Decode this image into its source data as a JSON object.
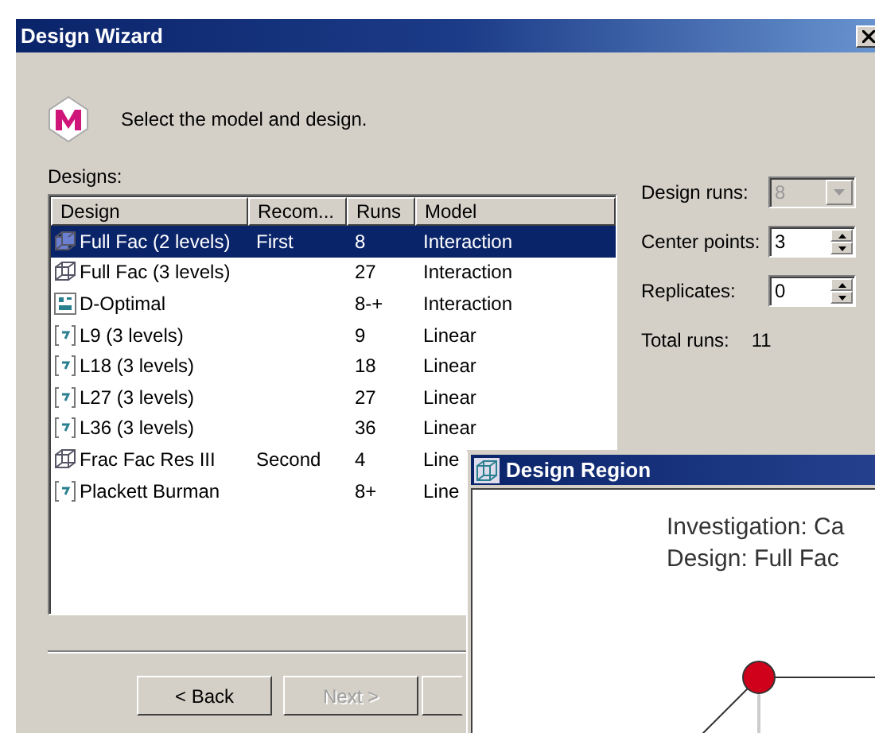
{
  "window": {
    "title": "Design Wizard"
  },
  "prompt": "Select the model and design.",
  "designs_label": "Designs:",
  "table": {
    "columns": [
      "Design",
      "Recom...",
      "Runs",
      "Model"
    ],
    "rows": [
      {
        "kind": "cube",
        "design": "Full Fac (2 levels)",
        "recommendation": "First",
        "runs": "8",
        "model": "Interaction",
        "selected": true
      },
      {
        "kind": "cube",
        "design": "Full Fac (3 levels)",
        "runs": "27",
        "model": "Interaction",
        "selected": false
      },
      {
        "kind": "d-optimal",
        "design": "D-Optimal",
        "runs": "8-+",
        "model": "Interaction",
        "selected": false
      },
      {
        "kind": "array",
        "design": "L9 (3 levels)",
        "runs": "9",
        "model": "Linear",
        "selected": false
      },
      {
        "kind": "array",
        "design": "L18 (3 levels)",
        "runs": "18",
        "model": "Linear",
        "selected": false
      },
      {
        "kind": "array",
        "design": "L27 (3 levels)",
        "runs": "27",
        "model": "Linear",
        "selected": false
      },
      {
        "kind": "array",
        "design": "L36 (3 levels)",
        "runs": "36",
        "model": "Linear",
        "selected": false
      },
      {
        "kind": "cube",
        "design": "Frac Fac Res III",
        "recommendation": "Second",
        "runs": "4",
        "model": "Line",
        "selected": false
      },
      {
        "kind": "array",
        "design": "Plackett Burman",
        "runs": "8+",
        "model": "Line",
        "selected": false
      }
    ]
  },
  "settings": [
    {
      "kind": "dropdown",
      "label": "Design runs:",
      "value": "8",
      "disabled": true
    },
    {
      "kind": "spin",
      "label": "Center points:",
      "value": "3",
      "disabled": false
    },
    {
      "kind": "spin",
      "label": "Replicates:",
      "value": "0",
      "disabled": false
    },
    {
      "kind": "readout",
      "label": "Total runs:",
      "value": "11"
    }
  ],
  "buttons": [
    {
      "label": "< Back",
      "disabled": false
    },
    {
      "label": "Next >",
      "disabled": true
    }
  ],
  "region_window": {
    "title": "Design Region",
    "lines": [
      "Investigation: Ca",
      "Design: Full Fac"
    ]
  }
}
